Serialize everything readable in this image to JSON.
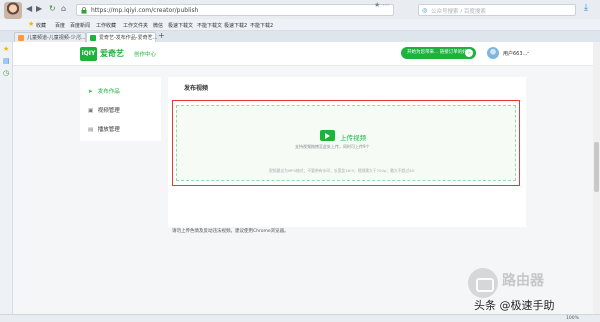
{
  "browser": {
    "nav": {
      "back": "◀",
      "forward": "▶",
      "reload": "↻",
      "home": "⌂"
    },
    "url": "https://mp.iqiyi.com/creator/publish",
    "address_tools": "★ ⋯",
    "search_placeholder": "公众号搜索 / 百度搜索",
    "download_icon": "download-icon"
  },
  "bookmarks": {
    "label": "收藏",
    "items": [
      "百度",
      "百度新闻",
      "工作收藏",
      "工作文件夹",
      "微信",
      "极速下载文",
      "不能下载文",
      "极速下载2",
      "不能下载2"
    ]
  },
  "tabs": [
    {
      "label": "儿童频道-儿童视频-少儿...",
      "active": false
    },
    {
      "label": "爱奇艺-发布作品-爱奇艺...",
      "active": true
    }
  ],
  "header": {
    "logo_mark": "iQIY",
    "logo_text": "爱奇艺",
    "logo_sub": "创作中心",
    "promo_label": "开始为您带来... 链接订单的好处",
    "user_name": "用户663..."
  },
  "side_menu": {
    "items": [
      {
        "icon": "send-icon",
        "glyph": "➤",
        "label": "发布作品",
        "active": true
      },
      {
        "icon": "video-manage-icon",
        "glyph": "▣",
        "label": "视频管理",
        "active": false
      },
      {
        "icon": "channel-manage-icon",
        "glyph": "▤",
        "label": "播放管理",
        "active": false
      }
    ]
  },
  "content": {
    "title": "发布视频",
    "upload_label": "上传视频",
    "upload_sub": "支持视频拖拽至此处上传，同时可上传9个",
    "upload_note": "视频建议为MP4格式；不要带有水印；长宽比16:9；视频需大于720p；最大不超过4G"
  },
  "hint": "请勿上传色情及反动违法视频。建议使用Chrome浏览器。",
  "watermark": {
    "brand": "路由器",
    "caption": "头条 @极速手助"
  },
  "status": {
    "zoom": "100%"
  },
  "colors": {
    "brand_green": "#1bb33b",
    "highlight_red": "#e53935"
  }
}
